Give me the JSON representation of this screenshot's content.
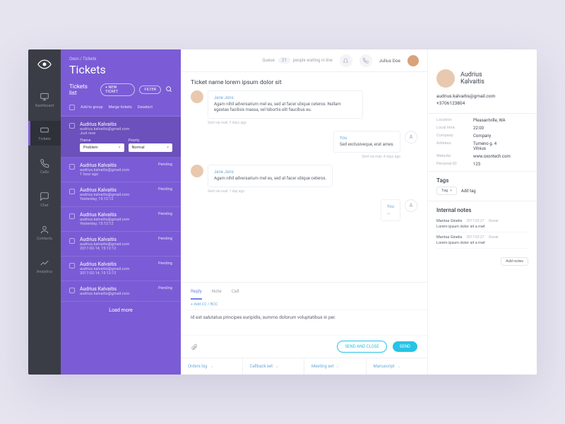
{
  "breadcrumb": "Oxon / Tickets",
  "page_title": "Tickets",
  "nav": {
    "items": [
      {
        "label": "Dashboard",
        "icon": "monitor"
      },
      {
        "label": "Tickets",
        "icon": "ticket"
      },
      {
        "label": "Calls",
        "icon": "phone"
      },
      {
        "label": "Chat",
        "icon": "chat"
      },
      {
        "label": "Contacts",
        "icon": "contacts"
      },
      {
        "label": "Analytics",
        "icon": "analytics"
      }
    ]
  },
  "list": {
    "title": "Tickets list",
    "new_btn": "+ NEW TICKET",
    "filter_btn": "FILTER",
    "bulk": {
      "add": "Add to group",
      "merge": "Merge tickets",
      "deselect": "Deselect"
    },
    "theme_label": "Theme",
    "priority_label": "Priority",
    "theme_value": "Problem",
    "priority_value": "Normal",
    "load_more": "Load more",
    "tickets": [
      {
        "name": "Audrius Kalvaitis",
        "email": "audrius.kalvaitis@gmail.com",
        "time": "Just now",
        "status": ""
      },
      {
        "name": "Audrius Kalvaitis",
        "email": "audrius.kalvaitis@gmail.com",
        "time": "1 hour ago",
        "status": "Pending"
      },
      {
        "name": "Audrius Kalvaitis",
        "email": "audrius.kalvaitis@gmail.com",
        "time": "Yesterday, 15:12:12",
        "status": "Pending"
      },
      {
        "name": "Audrius Kalvaitis",
        "email": "audrius.kalvaitis@gmail.com",
        "time": "Yesterday, 15:12:12",
        "status": "Pending"
      },
      {
        "name": "Audrius Kalvaitis",
        "email": "audrius.kalvaitis@gmail.com",
        "time": "2017-02-14, 15:12:12",
        "status": "Pending"
      },
      {
        "name": "Audrius Kalvaitis",
        "email": "audrius.kalvaitis@gmail.com",
        "time": "2017-02-14, 15:12:12",
        "status": "Pending"
      },
      {
        "name": "Audrius Kalvaitis",
        "email": "audrius.kalvaitis@gmail.com",
        "time": "",
        "status": "Pending"
      }
    ]
  },
  "topbar": {
    "queue_label": "Queue:",
    "queue_count": "21",
    "queue_suffix": "people waiting in line",
    "user": "Julius Doe"
  },
  "conversation": {
    "title": "Ticket name lorem ipsum dolor sit",
    "msgs": [
      {
        "dir": "in",
        "who": "Jane Jons",
        "text": "Agam nihil adversarium mel eu, sed at facer ubique ceteros. Nullam egestas facilisis massa, vel lobortis elit faucibus eu.",
        "meta": "Sent via mail, 3 days ago"
      },
      {
        "dir": "out",
        "who": "You",
        "text": "Sed exclusiveque, erat ames.",
        "meta": "Sent via mail, 4 days ago"
      },
      {
        "dir": "in",
        "who": "Jane Jons",
        "text": "Agam nihil adversarium mel eu, sed at facer ubique ceteros.",
        "meta": "Sent via mail, 1 day ago"
      },
      {
        "dir": "out",
        "who": "You",
        "text": "...",
        "meta": ""
      }
    ]
  },
  "compose": {
    "tabs": {
      "reply": "Reply",
      "note": "Note",
      "call": "Call"
    },
    "addcc": "+ Add CC / BCC",
    "body": "Id est salutatus principes euripidis, summo dolorum voluptatibus in per.",
    "send_close": "SEND AND CLOSE",
    "send": "SEND",
    "quick": [
      "Orders log",
      "Callback set",
      "Meeting set",
      "Manuscript"
    ]
  },
  "profile": {
    "name_first": "Audrius",
    "name_last": "Kalvaitis",
    "email": "audrius.kalvaitis@gmail.com",
    "phone": "+3706123804",
    "rows": [
      {
        "k": "Location:",
        "v": "Pleasantville, WA"
      },
      {
        "k": "Local time:",
        "v": "22:00"
      },
      {
        "k": "Company:",
        "v": "Company"
      },
      {
        "k": "Address:",
        "v": "Tumeno g. 4\nVilnius"
      },
      {
        "k": "Website:",
        "v": "www.oxontech.com"
      },
      {
        "k": "Personal ID:",
        "v": "123"
      }
    ],
    "tags_title": "Tags",
    "tag": "Tag",
    "add_tag": "Add tag",
    "notes_title": "Internal notes",
    "add_notes": "Add notes",
    "notes": [
      {
        "author": "Mantas Ginelis",
        "date": "2017-02-27",
        "who": "Owner",
        "body": "Lorem ipsum dolor sit a met"
      },
      {
        "author": "Mantas Ginelis",
        "date": "2017-02-27",
        "who": "Owner",
        "body": "Lorem ipsum dolor sit a met"
      }
    ]
  }
}
